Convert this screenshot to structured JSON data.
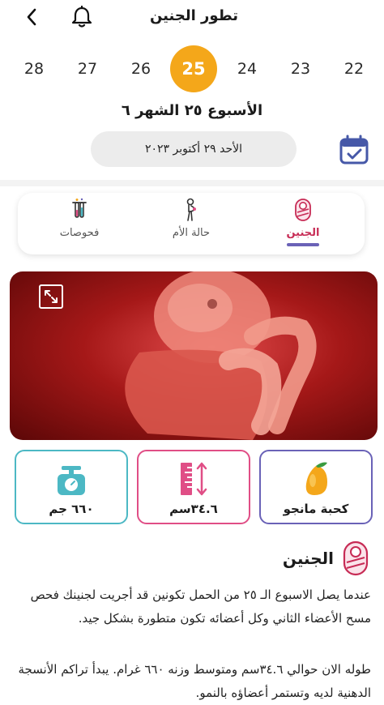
{
  "header": {
    "title": "تطور الجنين",
    "icons": {
      "back": "chevron-left-icon",
      "notifications": "bell-icon"
    }
  },
  "weeks": [
    "28",
    "27",
    "26",
    "25",
    "24",
    "23",
    "22"
  ],
  "selected_week": "25",
  "week_label": "الأسبوع ٢٥ الشهر ٦",
  "date": "الأحد ٢٩ أكتوبر ٢٠٢٣",
  "tabs": [
    {
      "label": "الجنين",
      "icon": "baby-icon",
      "active": true
    },
    {
      "label": "حالة الأم",
      "icon": "pregnant-mother-icon",
      "active": false
    },
    {
      "label": "فحوصات",
      "icon": "test-tubes-icon",
      "active": false
    }
  ],
  "stats": {
    "size": {
      "label": "كحبة مانجو",
      "icon": "mango-icon",
      "color": "#6a62b7"
    },
    "length": {
      "label": "٣٤.٦سم",
      "icon": "ruler-icon",
      "color": "#e04e86"
    },
    "weight": {
      "label": "٦٦٠ جم",
      "icon": "scale-icon",
      "color": "#4cb8c4"
    }
  },
  "section": {
    "title": "الجنين",
    "icon": "swaddled-baby-icon",
    "paragraph1": "عندما يصل الاسبوع الـ ٢٥ من الحمل تكونين قد أجريت لجنينك فحص مسح الأعضاء الثاني وكل أعضائه تكون متطورة بشكل جيد.",
    "paragraph2": "طوله الان حوالي ٣٤.٦سم ومتوسط وزنه ٦٦٠ غرام. يبدأ تراكم الأنسجة الدهنية لديه وتستمر أعضاؤه بالنمو."
  },
  "colors": {
    "accent": "#f4a71a",
    "brand_pink": "#c72b55",
    "brand_purple": "#6a62b7",
    "calendar_blue": "#4658a8"
  }
}
